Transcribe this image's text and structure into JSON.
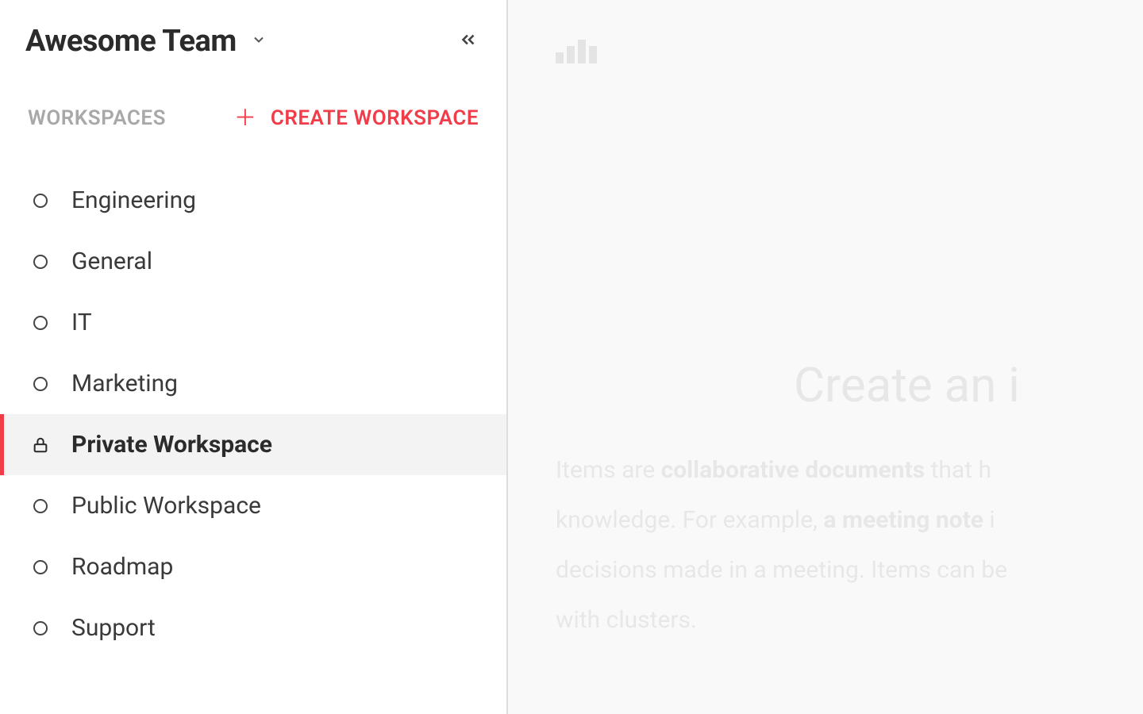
{
  "sidebar": {
    "team_name": "Awesome Team",
    "section_label": "WORKSPACES",
    "create_label": "CREATE WORKSPACE",
    "items": [
      {
        "label": "Engineering",
        "icon": "circle",
        "active": false
      },
      {
        "label": "General",
        "icon": "circle",
        "active": false
      },
      {
        "label": "IT",
        "icon": "circle",
        "active": false
      },
      {
        "label": "Marketing",
        "icon": "circle",
        "active": false
      },
      {
        "label": "Private Workspace",
        "icon": "lock",
        "active": true
      },
      {
        "label": "Public Workspace",
        "icon": "circle",
        "active": false
      },
      {
        "label": "Roadmap",
        "icon": "circle",
        "active": false
      },
      {
        "label": "Support",
        "icon": "circle",
        "active": false
      }
    ]
  },
  "main": {
    "title_fragment": "Create an i",
    "body_line1_a": "Items are ",
    "body_line1_b": "collaborative documents",
    "body_line1_c": " that h",
    "body_line2_a": "knowledge. For example, ",
    "body_line2_b": "a meeting note",
    "body_line2_c": " i",
    "body_line3": "decisions made in a meeting. Items can be",
    "body_line4": "with clusters."
  },
  "colors": {
    "accent": "#f13c4a",
    "text_dark": "#2b2b2b",
    "text_muted": "#a8a8a8",
    "hover_bg": "#f3f3f3"
  }
}
